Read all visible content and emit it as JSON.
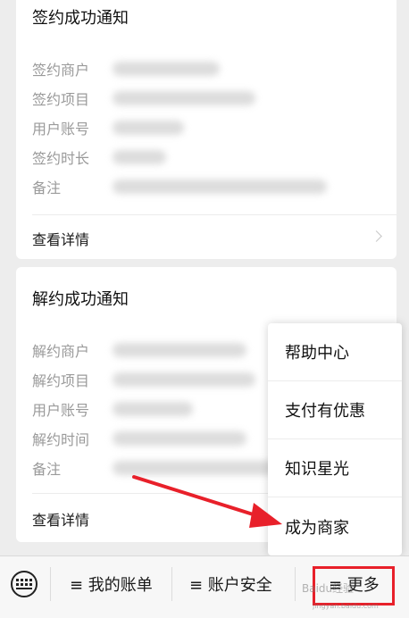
{
  "cards": [
    {
      "title": "签约成功通知",
      "rows": [
        {
          "label": "签约商户"
        },
        {
          "label": "签约项目"
        },
        {
          "label": "用户账号"
        },
        {
          "label": "签约时长"
        },
        {
          "label": "备注"
        }
      ],
      "detail_label": "查看详情"
    },
    {
      "title": "解约成功通知",
      "rows": [
        {
          "label": "解约商户"
        },
        {
          "label": "解约项目"
        },
        {
          "label": "用户账号"
        },
        {
          "label": "解约时间"
        },
        {
          "label": "备注"
        }
      ],
      "detail_label": "查看详情"
    }
  ],
  "popup_menu": {
    "items": [
      "帮助中心",
      "支付有优惠",
      "知识星光",
      "成为商家"
    ]
  },
  "bottom_bar": {
    "menu1": "≡ 我的账单",
    "menu2": "≡ 账户安全",
    "menu3": "≡ 更多"
  },
  "watermark": {
    "text": "Baidu经验",
    "sub": "jingyan.baidu.com"
  },
  "colors": {
    "highlight": "#e8202a",
    "arrow": "#e8202a"
  }
}
